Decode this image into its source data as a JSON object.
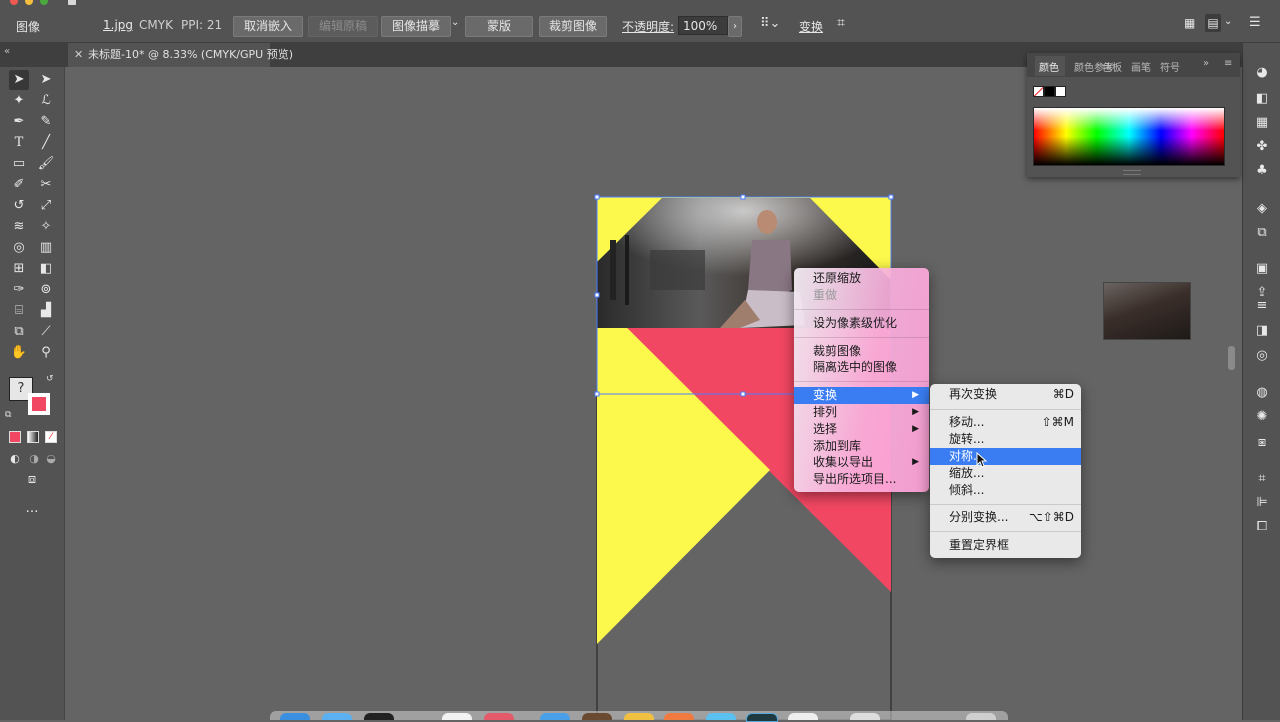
{
  "control_bar": {
    "object_type": "图像",
    "file_name": "1.jpg",
    "color_mode": "CMYK",
    "ppi": "PPI: 21",
    "unembed_btn": "取消嵌入",
    "edit_original_btn": "编辑原稿",
    "image_trace_btn": "图像描摹",
    "mask_btn": "蒙版",
    "crop_image_btn": "裁剪图像",
    "opacity_label": "不透明度:",
    "opacity_value": "100%",
    "transform_label": "变换"
  },
  "document_tab": {
    "title": "未标题-10* @ 8.33% (CMYK/GPU 预览)"
  },
  "color_panel": {
    "tabs": [
      "颜色",
      "颜色参考",
      "色板",
      "画笔",
      "符号"
    ]
  },
  "context_menu": {
    "items": {
      "reset_zoom": "还原缩放",
      "redo": "重做",
      "pixel_optimize": "设为像素级优化",
      "crop_image": "裁剪图像",
      "isolate_image": "隔离选中的图像",
      "transform": "变换",
      "arrange": "排列",
      "select": "选择",
      "add_to_library": "添加到库",
      "collect_for_export": "收集以导出",
      "export_selection": "导出所选项目..."
    }
  },
  "transform_submenu": {
    "items": {
      "transform_again": "再次变换",
      "transform_again_sc": "⌘D",
      "move": "移动...",
      "move_sc": "⇧⌘M",
      "rotate": "旋转...",
      "reflect": "对称...",
      "scale": "缩放...",
      "shear": "倾斜...",
      "transform_each": "分别变换...",
      "transform_each_sc": "⌥⇧⌘D",
      "reset_bbox": "重置定界框"
    }
  },
  "colors": {
    "yellow": "#FCF84C",
    "coral": "#F24763",
    "highlight": "#3A7DF2"
  }
}
